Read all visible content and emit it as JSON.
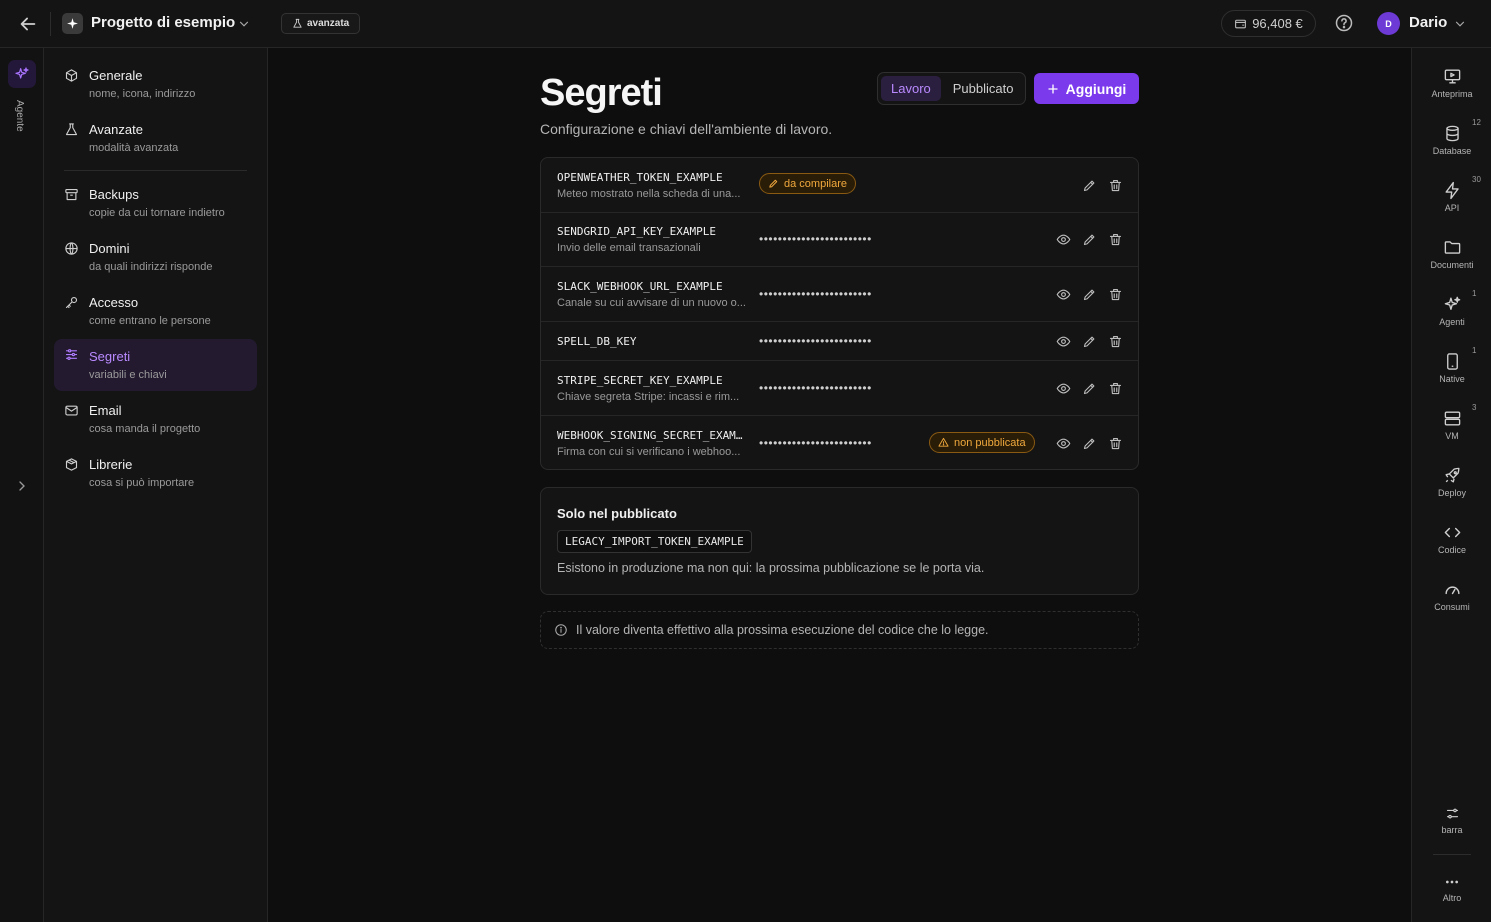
{
  "topbar": {
    "project": "Progetto di esempio",
    "mode_badge": "avanzata",
    "credit": "96,408 €",
    "user_initial": "D",
    "user_name": "Dario"
  },
  "agent_rail": {
    "label": "Agente"
  },
  "settings_nav": [
    {
      "label": "Generale",
      "sub": "nome, icona, indirizzo",
      "icon": "cube-icon"
    },
    {
      "label": "Avanzate",
      "sub": "modalità avanzata",
      "icon": "flask-icon"
    },
    {
      "label": "Backups",
      "sub": "copie da cui tornare indietro",
      "icon": "archive-icon"
    },
    {
      "label": "Domini",
      "sub": "da quali indirizzi risponde",
      "icon": "globe-icon"
    },
    {
      "label": "Accesso",
      "sub": "come entrano le persone",
      "icon": "key-icon"
    },
    {
      "label": "Segreti",
      "sub": "variabili e chiavi",
      "icon": "sliders-icon",
      "active": true
    },
    {
      "label": "Email",
      "sub": "cosa manda il progetto",
      "icon": "mail-icon"
    },
    {
      "label": "Librerie",
      "sub": "cosa si può importare",
      "icon": "package-icon"
    }
  ],
  "page": {
    "title": "Segreti",
    "subtitle": "Configurazione e chiavi dell'ambiente di lavoro.",
    "env_tabs": [
      "Lavoro",
      "Pubblicato"
    ],
    "active_env": "Lavoro",
    "add_label": "Aggiungi",
    "accent_color": "#7c3aed",
    "warning_color": "#f0a83c"
  },
  "secrets": [
    {
      "name": "OPENWEATHER_TOKEN_EXAMPLE",
      "desc": "Meteo mostrato nella scheda di una...",
      "value_mask": "",
      "badge": "da compilare"
    },
    {
      "name": "SENDGRID_API_KEY_EXAMPLE",
      "desc": "Invio delle email transazionali",
      "value_mask": "••••••••••••••••••••••••",
      "badge": ""
    },
    {
      "name": "SLACK_WEBHOOK_URL_EXAMPLE",
      "desc": "Canale su cui avvisare di un nuovo o...",
      "value_mask": "••••••••••••••••••••••••",
      "badge": ""
    },
    {
      "name": "SPELL_DB_KEY",
      "desc": "",
      "value_mask": "••••••••••••••••••••••••",
      "badge": ""
    },
    {
      "name": "STRIPE_SECRET_KEY_EXAMPLE",
      "desc": "Chiave segreta Stripe: incassi e rim...",
      "value_mask": "••••••••••••••••••••••••",
      "badge": ""
    },
    {
      "name": "WEBHOOK_SIGNING_SECRET_EXAM...",
      "desc": "Firma con cui si verificano i webhoo...",
      "value_mask": "••••••••••••••••••••••••",
      "badge": "non pubblicata"
    }
  ],
  "published_only": {
    "title": "Solo nel pubblicato",
    "chip": "LEGACY_IMPORT_TOKEN_EXAMPLE",
    "note": "Esistono in produzione ma non qui: la prossima pubblicazione se le porta via."
  },
  "info_note": "Il valore diventa effettivo alla prossima esecuzione del codice che lo legge.",
  "tools": [
    {
      "label": "Anteprima",
      "count": "",
      "icon": "monitor-icon"
    },
    {
      "label": "Database",
      "count": "12",
      "icon": "database-icon"
    },
    {
      "label": "API",
      "count": "30",
      "icon": "bolt-icon"
    },
    {
      "label": "Documenti",
      "count": "",
      "icon": "folder-icon"
    },
    {
      "label": "Agenti",
      "count": "1",
      "icon": "sparkles-icon"
    },
    {
      "label": "Native",
      "count": "1",
      "icon": "phone-icon"
    },
    {
      "label": "VM",
      "count": "3",
      "icon": "server-icon"
    },
    {
      "label": "Deploy",
      "count": "",
      "icon": "rocket-icon"
    },
    {
      "label": "Codice",
      "count": "",
      "icon": "code-icon"
    },
    {
      "label": "Consumi",
      "count": "",
      "icon": "gauge-icon"
    }
  ],
  "tools_bottom": [
    {
      "label": "barra",
      "icon": "toggle-icon"
    },
    {
      "label": "Altro",
      "icon": "more-icon"
    }
  ]
}
